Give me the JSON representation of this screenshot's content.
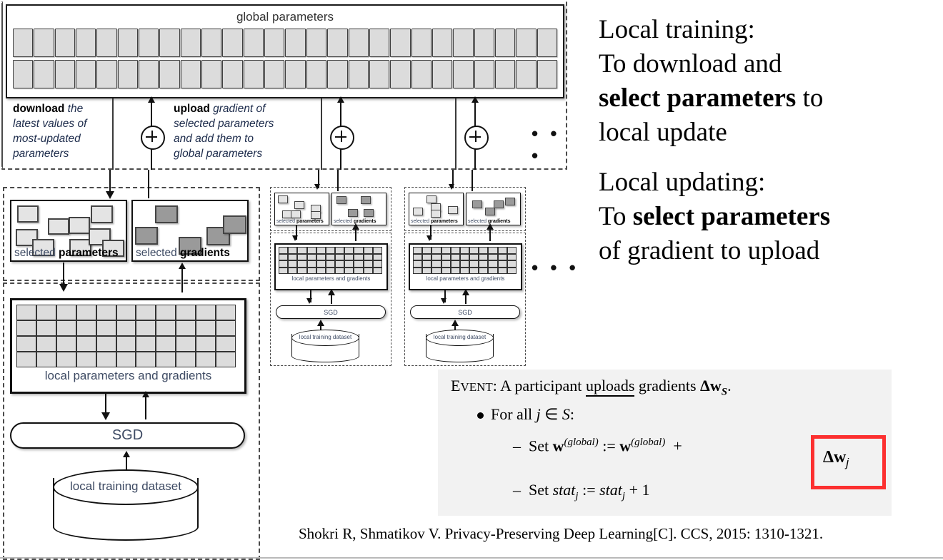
{
  "diagram": {
    "global": {
      "title": "global parameters",
      "cells_per_row": 26,
      "rows": 2
    },
    "band": {
      "download_bold": "download",
      "download_rest": " the latest values of most-updated parameters",
      "download_lines": [
        "download| the",
        "latest values of",
        "most-updated",
        "parameters"
      ],
      "upload_bold": "upload",
      "upload_lines": [
        "upload| gradient of",
        "selected parameters",
        "and add them to",
        "global parameters"
      ],
      "plus_symbol": "+",
      "ellipsis": "• • •"
    },
    "participant": {
      "selected_parameters_prefix": "selected ",
      "selected_parameters_bold": "parameters",
      "selected_gradients_prefix": "selected ",
      "selected_gradients_bold": "gradients",
      "local_grid_caption": "local parameters and gradients",
      "grid_cols": 11,
      "grid_rows": 4,
      "sgd_label": "SGD",
      "dataset_label": "local training dataset"
    },
    "ellipsis": "• • •",
    "colors": {
      "cell_fill": "#dcdcdc",
      "gradient_fill": "#9a9a9a",
      "caption_text": "#3d4a63",
      "dash_stroke": "#4a4a4a"
    }
  },
  "right_panel": {
    "blocks": [
      {
        "lines": [
          {
            "parts": [
              {
                "t": "Local training:",
                "b": false
              }
            ]
          },
          {
            "parts": [
              {
                "t": "To download and",
                "b": false
              }
            ]
          },
          {
            "parts": [
              {
                "t": "select parameters",
                "b": true
              },
              {
                "t": " to",
                "b": false
              }
            ]
          },
          {
            "parts": [
              {
                "t": "local update",
                "b": false
              }
            ]
          }
        ]
      },
      {
        "lines": [
          {
            "parts": [
              {
                "t": "Local updating:",
                "b": false
              }
            ]
          },
          {
            "parts": [
              {
                "t": "To ",
                "b": false
              },
              {
                "t": "select parameters",
                "b": true
              }
            ]
          },
          {
            "parts": [
              {
                "t": "of gradient to upload",
                "b": false
              }
            ]
          }
        ]
      }
    ]
  },
  "event_box": {
    "head_event": "EVENT",
    "head_rest_1": ": A participant ",
    "head_underlined": "uploads",
    "head_rest_2": " gradients ",
    "head_math": "Δw_S.",
    "bullet": "For all j ∈ S:",
    "line1": "Set w(global) := w(global) +",
    "line1_boxed": "Δw_j",
    "line2": "Set stat_j := stat_j + 1",
    "box_color": "#fc3030",
    "background": "#f2f2f2"
  },
  "citation": "Shokri R, Shmatikov V. Privacy-Preserving Deep Learning[C]. CCS, 2015: 1310-1321."
}
